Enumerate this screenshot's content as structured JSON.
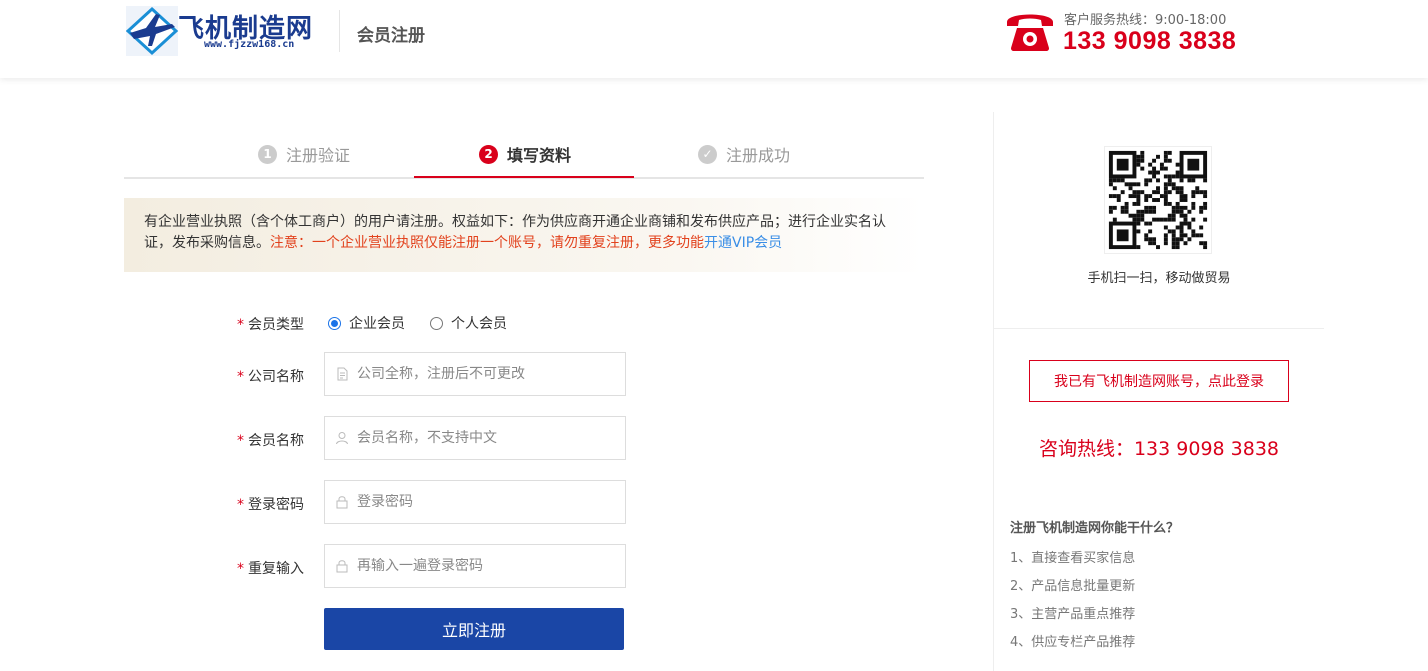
{
  "header": {
    "logo_text": "飞机制造网",
    "logo_url": "www.fjzzw168.cn",
    "page_title": "会员注册",
    "hotline_label": "客户服务热线：9:00-18:00",
    "hotline_number": "133 9098 3838"
  },
  "steps": [
    {
      "num": "1",
      "label": "注册验证",
      "state": "done"
    },
    {
      "num": "2",
      "label": "填写资料",
      "state": "active"
    },
    {
      "num": "✓",
      "label": "注册成功",
      "state": "pending"
    }
  ],
  "notice": {
    "text": "有企业营业执照（含个体工商户）的用户请注册。权益如下：作为供应商开通企业商铺和发布供应产品；进行企业实名认证，发布采购信息。",
    "warning": "注意：一个企业营业执照仅能注册一个账号，请勿重复注册，更多功能",
    "vip_link": "开通VIP会员"
  },
  "form": {
    "required_mark": "*",
    "member_type_label": "会员类型",
    "member_type_options": [
      "企业会员",
      "个人会员"
    ],
    "member_type_selected": "企业会员",
    "company_label": "公司名称",
    "company_placeholder": "公司全称，注册后不可更改",
    "member_name_label": "会员名称",
    "member_name_placeholder": "会员名称，不支持中文",
    "password_label": "登录密码",
    "password_placeholder": "登录密码",
    "repeat_label": "重复输入",
    "repeat_placeholder": "再输入一遍登录密码",
    "submit_label": "立即注册"
  },
  "sidebar": {
    "qr_caption": "手机扫一扫，移动做贸易",
    "login_link": "我已有飞机制造网账号，点此登录",
    "consult_hotline": "咨询热线：133 9098 3838",
    "why_title": "注册飞机制造网你能干什么？",
    "why_items": [
      "1、直接查看买家信息",
      "2、产品信息批量更新",
      "3、主营产品重点推荐",
      "4、供应专栏产品推荐"
    ]
  },
  "colors": {
    "brand_red": "#d9001b",
    "brand_blue": "#1a46a6",
    "link_blue": "#3a8ee6"
  },
  "icons": {
    "logo": "airplane-logo-icon",
    "phone": "telephone-icon",
    "company_field": "document-icon",
    "member_field": "user-icon",
    "password_field": "lock-icon"
  }
}
